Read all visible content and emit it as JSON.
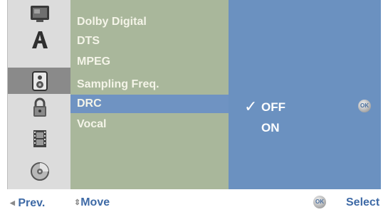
{
  "menu": {
    "items": [
      {
        "label": "Dolby Digital"
      },
      {
        "label": "DTS"
      },
      {
        "label": "MPEG"
      },
      {
        "label": "Sampling Freq."
      },
      {
        "label": "DRC"
      },
      {
        "label": "Vocal"
      }
    ],
    "selected_index": 4
  },
  "options": {
    "items": [
      {
        "label": "OFF",
        "checked": true
      },
      {
        "label": "ON",
        "checked": false
      }
    ],
    "check_glyph": "✓",
    "ok_badge": "OK"
  },
  "sidebar": {
    "icons": [
      "picture-icon",
      "language-icon",
      "audio-icon",
      "lock-icon",
      "film-icon",
      "disc-icon"
    ],
    "active_index": 2
  },
  "footer": {
    "prev": "Prev.",
    "move": "Move",
    "ok_badge": "OK",
    "select": "Select"
  },
  "colors": {
    "menu_bg": "#a9b79b",
    "selected_row": "#6f93c2",
    "options_bg": "#6b91c0",
    "sidebar_bg": "#dcdcdc",
    "sidebar_active": "#8a8a8a",
    "footer_text": "#3e6aa6"
  }
}
